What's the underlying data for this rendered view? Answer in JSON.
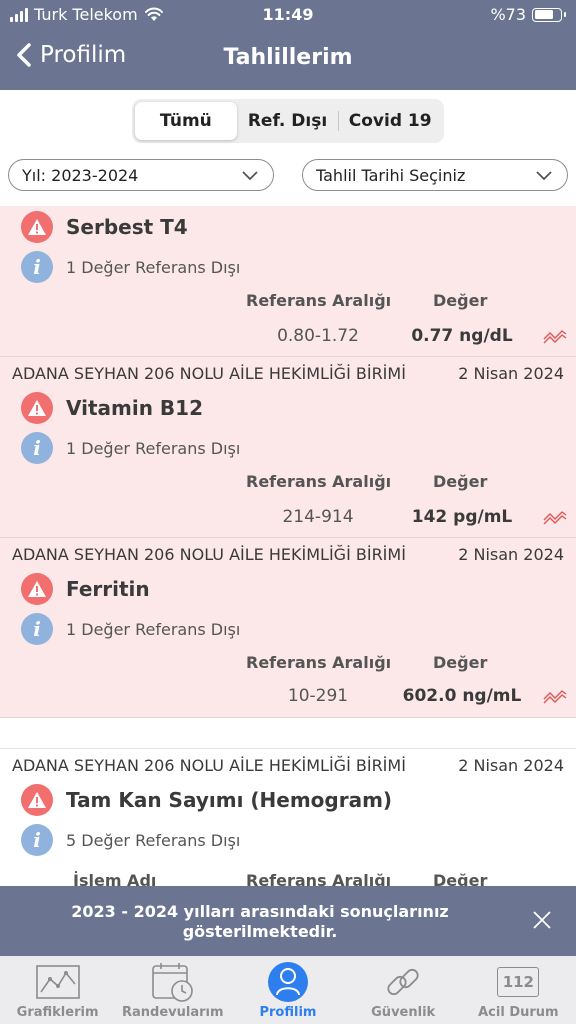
{
  "status_bar": {
    "carrier": "Turk Telekom",
    "time": "11:49",
    "battery": "%73",
    "battery_level": 0.73
  },
  "nav": {
    "back_label": "Profilim",
    "title": "Tahlillerim"
  },
  "segment": {
    "items": [
      "Tümü",
      "Ref. Dışı",
      "Covid 19"
    ],
    "selected": "Tümü"
  },
  "filters": {
    "year": "Yıl: 2023-2024",
    "date": "Tahlil Tarihi Seçiniz"
  },
  "columns": {
    "islem": "İşlem Adı",
    "ref": "Referans Aralığı",
    "value": "Değer"
  },
  "results": [
    {
      "institution": "",
      "date": "",
      "name": "Serbest T4",
      "info": "1 Değer Referans Dışı",
      "ref_range": "0.80-1.72",
      "value": "0.77 ng/dL",
      "out_of_range": true
    },
    {
      "institution": "ADANA SEYHAN 206 NOLU AİLE HEKİMLİĞİ BİRİMİ",
      "date": "2 Nisan 2024",
      "name": "Vitamin B12",
      "info": "1 Değer Referans Dışı",
      "ref_range": "214-914",
      "value": "142 pg/mL",
      "out_of_range": true
    },
    {
      "institution": "ADANA SEYHAN 206 NOLU AİLE HEKİMLİĞİ BİRİMİ",
      "date": "2 Nisan 2024",
      "name": "Ferritin",
      "info": "1 Değer Referans Dışı",
      "ref_range": "10-291",
      "value": "602.0 ng/mL",
      "out_of_range": true
    },
    {
      "institution": "ADANA SEYHAN 206 NOLU AİLE HEKİMLİĞİ BİRİMİ",
      "date": "2 Nisan 2024",
      "name": "Tam Kan Sayımı (Hemogram)",
      "info": "5 Değer Referans Dışı",
      "out_of_range": false
    }
  ],
  "toast": {
    "message": "2023 - 2024 yılları arasındaki sonuçlarınız gösterilmektedir."
  },
  "tabbar": {
    "items": [
      "Grafiklerim",
      "Randevularım",
      "Profilim",
      "Güvenlik",
      "Acil Durum"
    ],
    "emergency_number": "112",
    "active": "Profilim"
  },
  "colors": {
    "header": "#6b7591",
    "alert_bg": "#fce8e8",
    "warn": "#f16f6f",
    "info": "#8fb3dc",
    "active_tab": "#2d7ff0",
    "trend": "#e25555"
  }
}
